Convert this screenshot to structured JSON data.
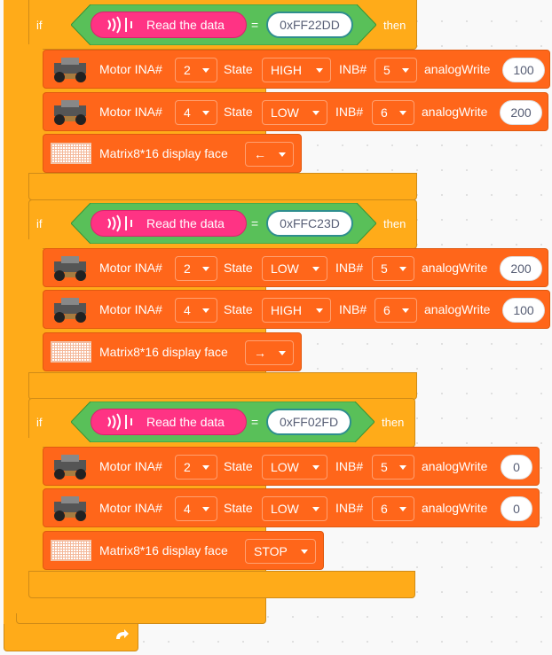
{
  "colors": {
    "control": "#FFAB19",
    "motor": "#FF661A",
    "sensor": "#FF3384",
    "operator": "#59C059"
  },
  "blocks": [
    {
      "if_label": "if",
      "then_label": "then",
      "condition": {
        "reporter": "Read the data",
        "operator": "=",
        "value": "0xFF22DD"
      },
      "motors": [
        {
          "label": "Motor INA#",
          "ina": "2",
          "state_label": "State",
          "state": "HIGH",
          "inb_label": "INB#",
          "inb": "5",
          "analog_label": "analogWrite",
          "analog": "100"
        },
        {
          "label": "Motor INA#",
          "ina": "4",
          "state_label": "State",
          "state": "LOW",
          "inb_label": "INB#",
          "inb": "6",
          "analog_label": "analogWrite",
          "analog": "200"
        }
      ],
      "matrix": {
        "label": "Matrix8*16 display face",
        "face": "←"
      }
    },
    {
      "if_label": "if",
      "then_label": "then",
      "condition": {
        "reporter": "Read the data",
        "operator": "=",
        "value": "0xFFC23D"
      },
      "motors": [
        {
          "label": "Motor INA#",
          "ina": "2",
          "state_label": "State",
          "state": "LOW",
          "inb_label": "INB#",
          "inb": "5",
          "analog_label": "analogWrite",
          "analog": "200"
        },
        {
          "label": "Motor INA#",
          "ina": "4",
          "state_label": "State",
          "state": "HIGH",
          "inb_label": "INB#",
          "inb": "6",
          "analog_label": "analogWrite",
          "analog": "100"
        }
      ],
      "matrix": {
        "label": "Matrix8*16 display face",
        "face": "→"
      }
    },
    {
      "if_label": "if",
      "then_label": "then",
      "condition": {
        "reporter": "Read the data",
        "operator": "=",
        "value": "0xFF02FD"
      },
      "motors": [
        {
          "label": "Motor INA#",
          "ina": "2",
          "state_label": "State",
          "state": "LOW",
          "inb_label": "INB#",
          "inb": "5",
          "analog_label": "analogWrite",
          "analog": "0"
        },
        {
          "label": "Motor INA#",
          "ina": "4",
          "state_label": "State",
          "state": "LOW",
          "inb_label": "INB#",
          "inb": "6",
          "analog_label": "analogWrite",
          "analog": "0"
        }
      ],
      "matrix": {
        "label": "Matrix8*16 display face",
        "face": "STOP"
      }
    }
  ],
  "icons": {
    "motor": "robot-car-icon",
    "matrix": "led-matrix-icon",
    "ir": "ir-receiver-icon",
    "loop": "loop-arrow-icon"
  }
}
